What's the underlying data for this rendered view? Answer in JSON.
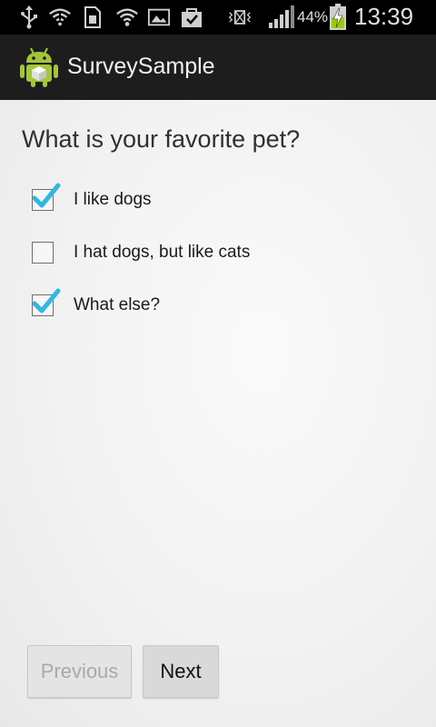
{
  "status_bar": {
    "battery_percent": "44%",
    "time": "13:39",
    "icons": [
      "usb-icon",
      "wifi-alert-icon",
      "sim-icon",
      "wifi-icon",
      "gallery-icon",
      "shopping-bag-icon",
      "vibrate-icon",
      "signal-icon",
      "battery-charging-icon"
    ]
  },
  "action_bar": {
    "title": "SurveySample",
    "icon": "android-app-icon"
  },
  "survey": {
    "question": "What is your favorite pet?",
    "options": [
      {
        "label": "I like dogs",
        "checked": true
      },
      {
        "label": "I hat dogs, but like cats",
        "checked": false
      },
      {
        "label": "What else?",
        "checked": true
      }
    ]
  },
  "buttons": {
    "previous_label": "Previous",
    "previous_enabled": false,
    "next_label": "Next"
  },
  "colors": {
    "check_accent": "#33b5e5",
    "action_bar_bg": "#1d1d1d",
    "status_bar_bg": "#000000"
  }
}
